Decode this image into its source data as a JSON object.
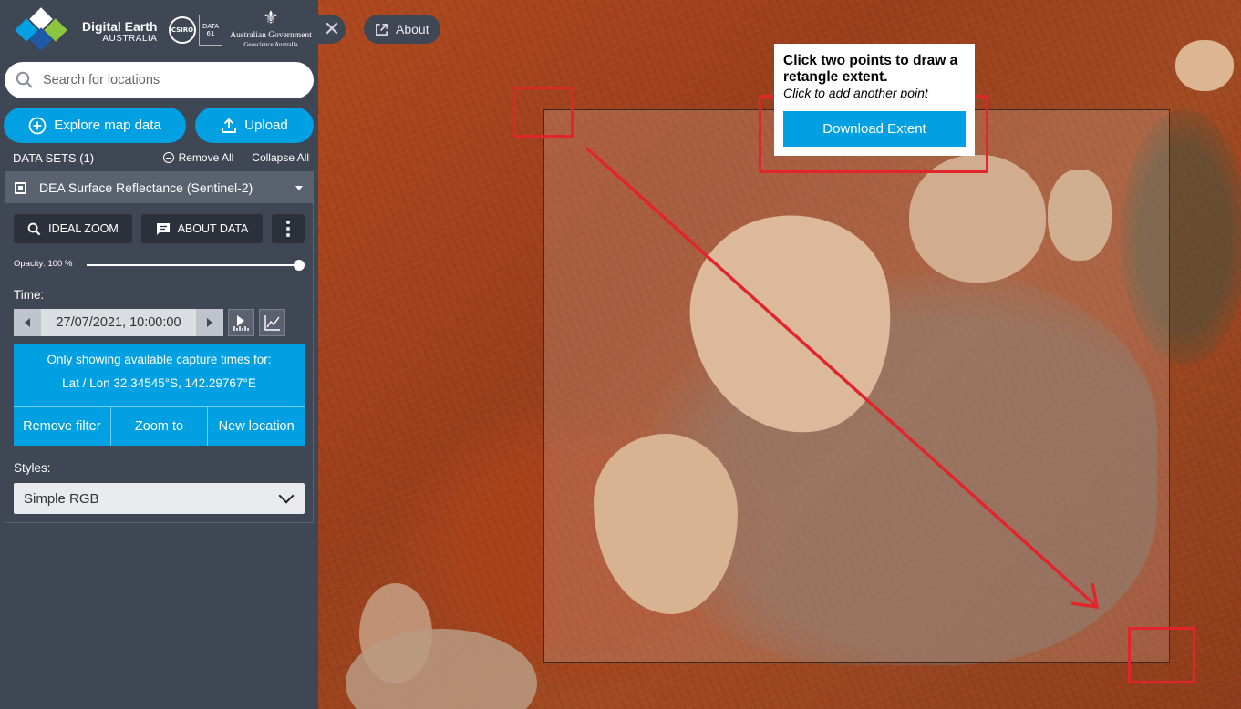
{
  "brand": {
    "name_line1": "Digital Earth",
    "name_line2": "AUSTRALIA",
    "csiro": "CSIRO",
    "data61": "DATA 61",
    "gov_line1": "Australian Government",
    "gov_line2": "Geoscience Australia"
  },
  "search": {
    "placeholder": "Search for locations"
  },
  "actions": {
    "explore_label": "Explore map data",
    "upload_label": "Upload"
  },
  "datasets": {
    "title": "DATA SETS (1)",
    "remove_all": "Remove All",
    "collapse_all": "Collapse All",
    "items": [
      {
        "label": "DEA Surface Reflectance (Sentinel-2)",
        "ideal_zoom": "IDEAL ZOOM",
        "about_data": "ABOUT DATA",
        "opacity_label": "Opacity: 100 %",
        "opacity": 1.0,
        "time_label": "Time:",
        "date": "27/07/2021, 10:00:00",
        "filter_line1": "Only showing available capture times for:",
        "filter_line2": "Lat / Lon 32.34545°S, 142.29767°E",
        "filter_actions": [
          "Remove filter",
          "Zoom to",
          "New location"
        ],
        "styles_label": "Styles:",
        "style_value": "Simple RGB"
      }
    ]
  },
  "map": {
    "about_label": "About",
    "popup": {
      "title": "Click two points to draw a retangle extent.",
      "subtitle": "Click to add another point",
      "download_label": "Download Extent"
    }
  },
  "colors": {
    "accent": "#00a0e2",
    "panel": "#3f4654",
    "annotation": "#e0262b"
  }
}
